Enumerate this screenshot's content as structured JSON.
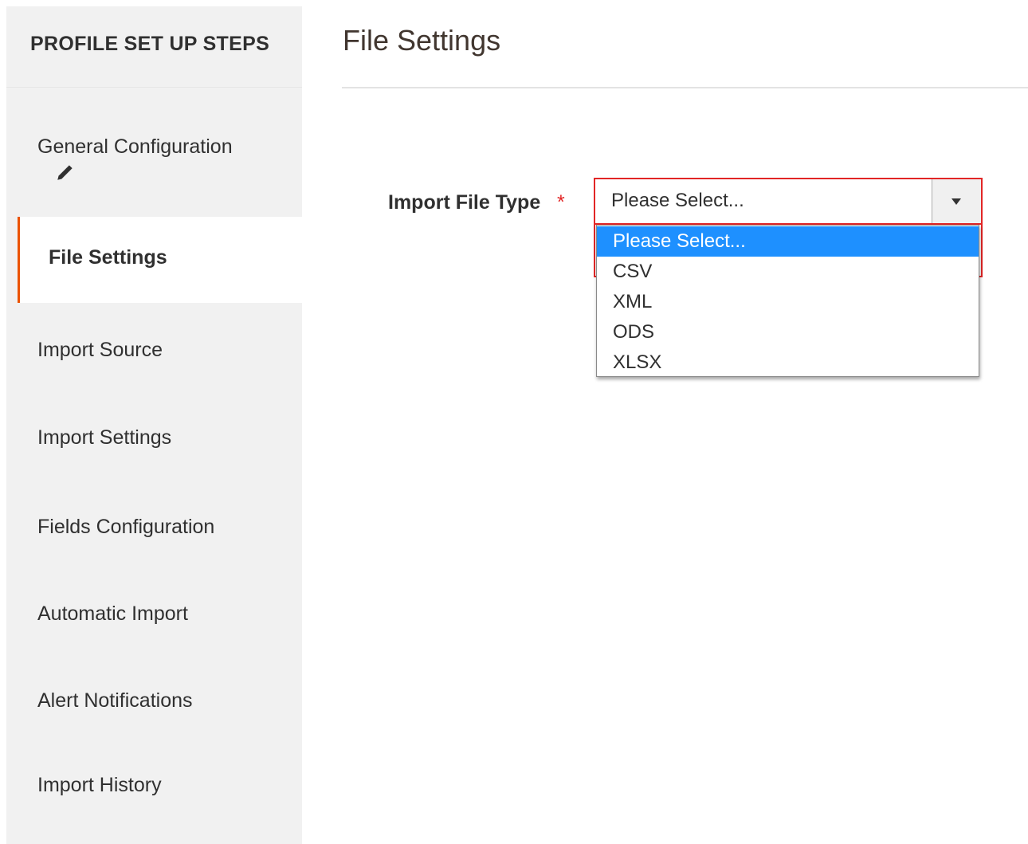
{
  "sidebar": {
    "title": "PROFILE SET UP STEPS",
    "steps": [
      {
        "label": "General Configuration",
        "icon": "pencil-icon"
      },
      {
        "label": "File Settings",
        "active": true
      },
      {
        "label": "Import Source"
      },
      {
        "label": "Import Settings"
      },
      {
        "label": "Fields Configuration"
      },
      {
        "label": "Automatic Import"
      },
      {
        "label": "Alert Notifications"
      },
      {
        "label": "Import History"
      }
    ]
  },
  "main": {
    "title": "File Settings",
    "field": {
      "label": "Import File Type",
      "required_mark": "*",
      "value": "Please Select...",
      "options": [
        "Please Select...",
        "CSV",
        "XML",
        "ODS",
        "XLSX"
      ],
      "highlighted_option": "Please Select..."
    }
  },
  "colors": {
    "active_accent": "#eb5202",
    "error_border": "#e22626",
    "highlight": "#1e90ff",
    "sidebar_bg": "#f1f1f1"
  }
}
